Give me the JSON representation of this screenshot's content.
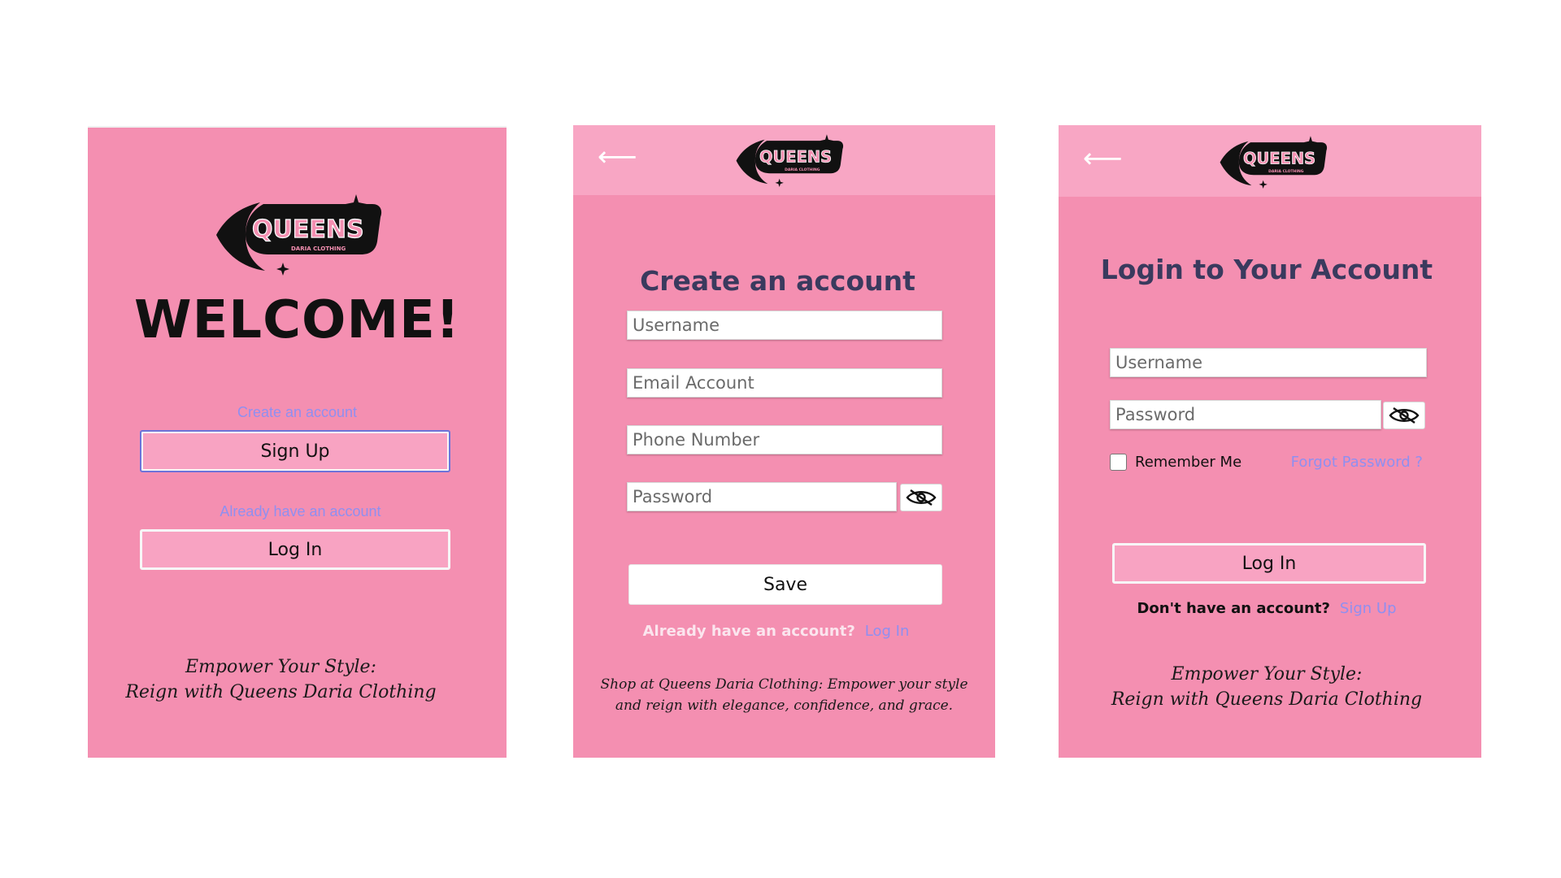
{
  "welcome_screen": {
    "title": "WELCOME!",
    "create_hint": "Create an account",
    "signup_label": "Sign Up",
    "login_hint": "Already have an account",
    "login_label": "Log In",
    "slogan_line1": "Empower Your Style:",
    "slogan_line2": "Reign with Queens Daria Clothing"
  },
  "logo": {
    "brand": "QUEENS",
    "sub": "DARIA CLOTHING"
  },
  "signup_screen": {
    "back_icon": "back-arrow-icon",
    "title": "Create an account",
    "username_placeholder": "Username",
    "email_placeholder": "Email Account",
    "phone_placeholder": "Phone Number",
    "password_placeholder": "Password",
    "save_label": "Save",
    "have_account": "Already have an account?",
    "login_link": "Log In",
    "slogan_line1": "Shop at Queens Daria Clothing: Empower your style",
    "slogan_line2": "and reign with elegance, confidence, and grace."
  },
  "login_screen": {
    "back_icon": "back-arrow-icon",
    "title": "Login to Your Account",
    "username_placeholder": "Username",
    "password_placeholder": "Password",
    "remember_label": "Remember Me",
    "forgot_label": "Forgot Password ?",
    "login_label": "Log In",
    "no_account": "Don't have an account?",
    "signup_link": "Sign Up",
    "slogan_line1": "Empower Your Style:",
    "slogan_line2": "Reign with Queens Daria Clothing"
  },
  "colors": {
    "panel_bg": "#f48fb1",
    "topbar_bg": "#f8a6c4",
    "button_bg": "#f8a3c2",
    "link": "#8f8ff0",
    "title": "#3a3a5e"
  }
}
